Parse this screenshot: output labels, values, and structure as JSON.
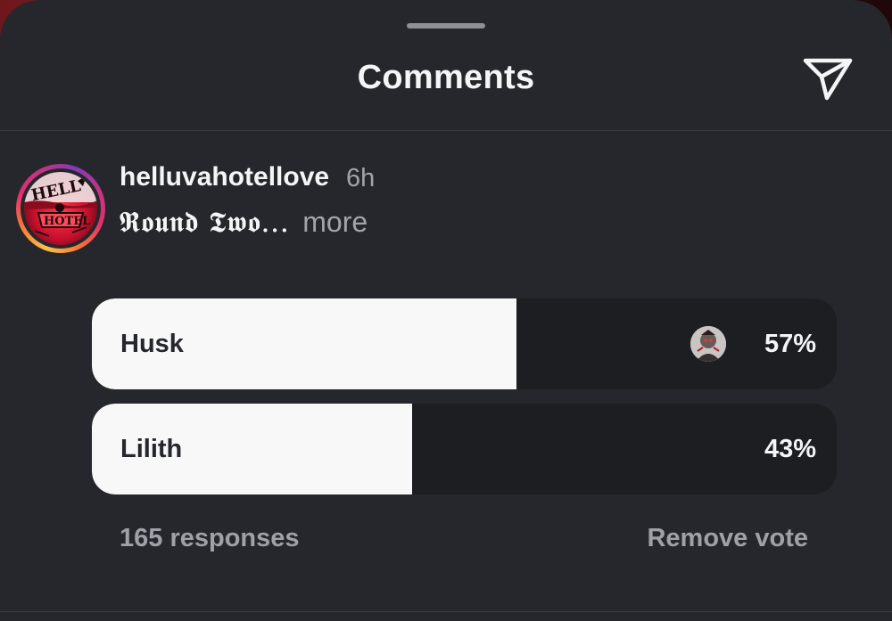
{
  "sheet": {
    "title": "Comments",
    "send_icon": "paper-plane-icon"
  },
  "post": {
    "username": "helluvahotellove",
    "time": "6h",
    "caption": "𝕽𝖔𝖚𝖓𝖉 𝕿𝖜𝖔...",
    "more_label": "more",
    "avatar_icon": "hazbin-hotel-logo-avatar",
    "avatar_logo_text": "HELLO HOTEL"
  },
  "poll": {
    "options": [
      {
        "label": "Husk",
        "percent": 57,
        "percent_label": "57%",
        "voted": true,
        "fill_color": "#f7f8f7"
      },
      {
        "label": "Lilith",
        "percent": 43,
        "percent_label": "43%",
        "voted": false,
        "fill_color": "#f7f8f7"
      }
    ],
    "responses_label": "165 responses",
    "remove_vote_label": "Remove vote",
    "track_color": "#1d1e22"
  },
  "colors": {
    "background": "#26272c",
    "text_primary": "#f4f5f7",
    "text_secondary": "#a2a4aa",
    "story_ring": [
      "#f9c24a",
      "#f77737",
      "#e1306c",
      "#c13584",
      "#833ab4"
    ]
  }
}
